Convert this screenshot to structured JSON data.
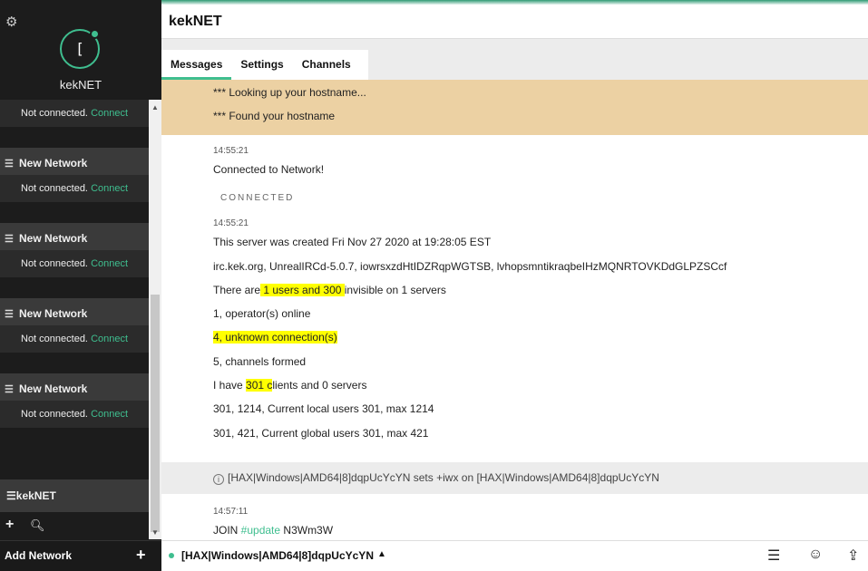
{
  "sidebar": {
    "gear_icon": "gear-icon",
    "avatar_letter": "[",
    "brand": "kekNET",
    "networks": [
      {
        "status": "Not connected.",
        "connect": "Connect"
      },
      {
        "name": "New Network",
        "status": "Not connected.",
        "connect": "Connect"
      },
      {
        "name": "New Network",
        "status": "Not connected.",
        "connect": "Connect"
      },
      {
        "name": "New Network",
        "status": "Not connected.",
        "connect": "Connect"
      },
      {
        "name": "New Network",
        "status": "Not connected.",
        "connect": "Connect"
      }
    ],
    "active_network": "kekNET",
    "add_network": "Add Network"
  },
  "header": {
    "title": "kekNET"
  },
  "tabs": [
    {
      "label": "Messages",
      "active": true
    },
    {
      "label": "Settings"
    },
    {
      "label": "Channels"
    }
  ],
  "messages": {
    "motd": [
      "*** Looking up your hostname...",
      "*** Found your hostname"
    ],
    "block1": {
      "time": "14:55:21",
      "text": "Connected to Network!"
    },
    "connected_label": "CONNECTED",
    "block2": {
      "time": "14:55:21",
      "created": "This server was created Fri Nov 27 2020 at 19:28:05 EST",
      "server_info": "irc.kek.org, UnrealIRCd-5.0.7, iowrsxzdHtIDZRqpWGTSB, lvhopsmntikraqbeIHzMQNRTOVKDdGLPZSCcf",
      "users_pre": "There are",
      "users_hl": " 1 users and 300 ",
      "users_post": "invisible on 1 servers",
      "operators": "1, operator(s) online",
      "unknown": "4, unknown connection(s)",
      "channels": "5, channels formed",
      "clients_pre": "I have ",
      "clients_hl": "301 c",
      "clients_post": "lients and 0 servers",
      "local": "301, 1214, Current local users 301, max 1214",
      "global": "301, 421, Current global users 301, max 421"
    },
    "mode_info": "[HAX|Windows|AMD64|8]dqpUcYcYN sets +iwx on [HAX|Windows|AMD64|8]dqpUcYcYN",
    "block3": {
      "time": "14:57:11",
      "join_pre": "JOIN ",
      "channel": "#update",
      "join_post": " N3Wm3W"
    }
  },
  "input": {
    "nick": "[HAX|Windows|AMD64|8]dqpUcYcYN"
  },
  "colors": {
    "accent": "#3fbe8f",
    "sidebar_bg": "#1c1c1c",
    "motd_bg": "#ecd1a3",
    "highlight": "#ffff00"
  }
}
